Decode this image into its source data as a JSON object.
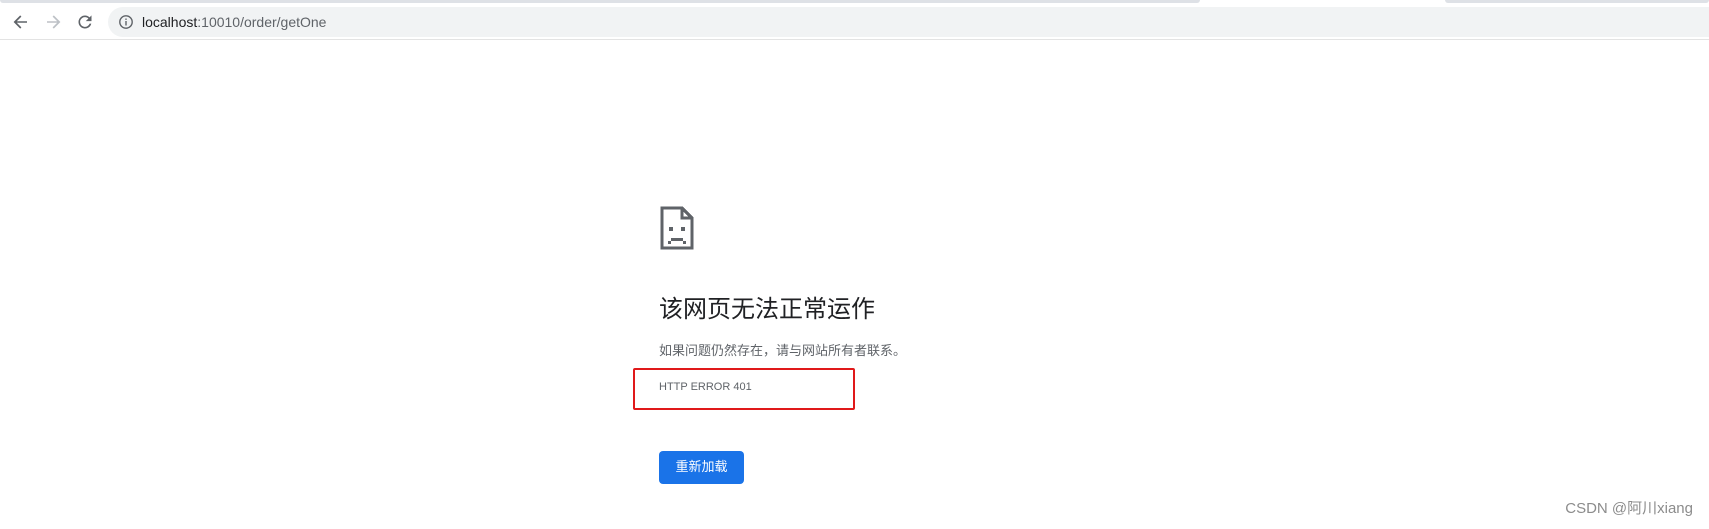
{
  "browser": {
    "address_bar": {
      "host": "localhost",
      "path": ":10010/order/getOne"
    },
    "icons": {
      "back": "back-arrow-icon",
      "forward": "forward-arrow-icon",
      "reload": "reload-icon",
      "site_info": "info-icon"
    }
  },
  "error_page": {
    "icon": "sad-document-icon",
    "heading": "该网页无法正常运作",
    "message": "如果问题仍然存在，请与网站所有者联系。",
    "error_code": "HTTP ERROR 401",
    "reload_button": "重新加载",
    "colors": {
      "button": "#1a73e8",
      "highlight": "#e0191a"
    }
  },
  "watermark": "CSDN @阿川xiang"
}
